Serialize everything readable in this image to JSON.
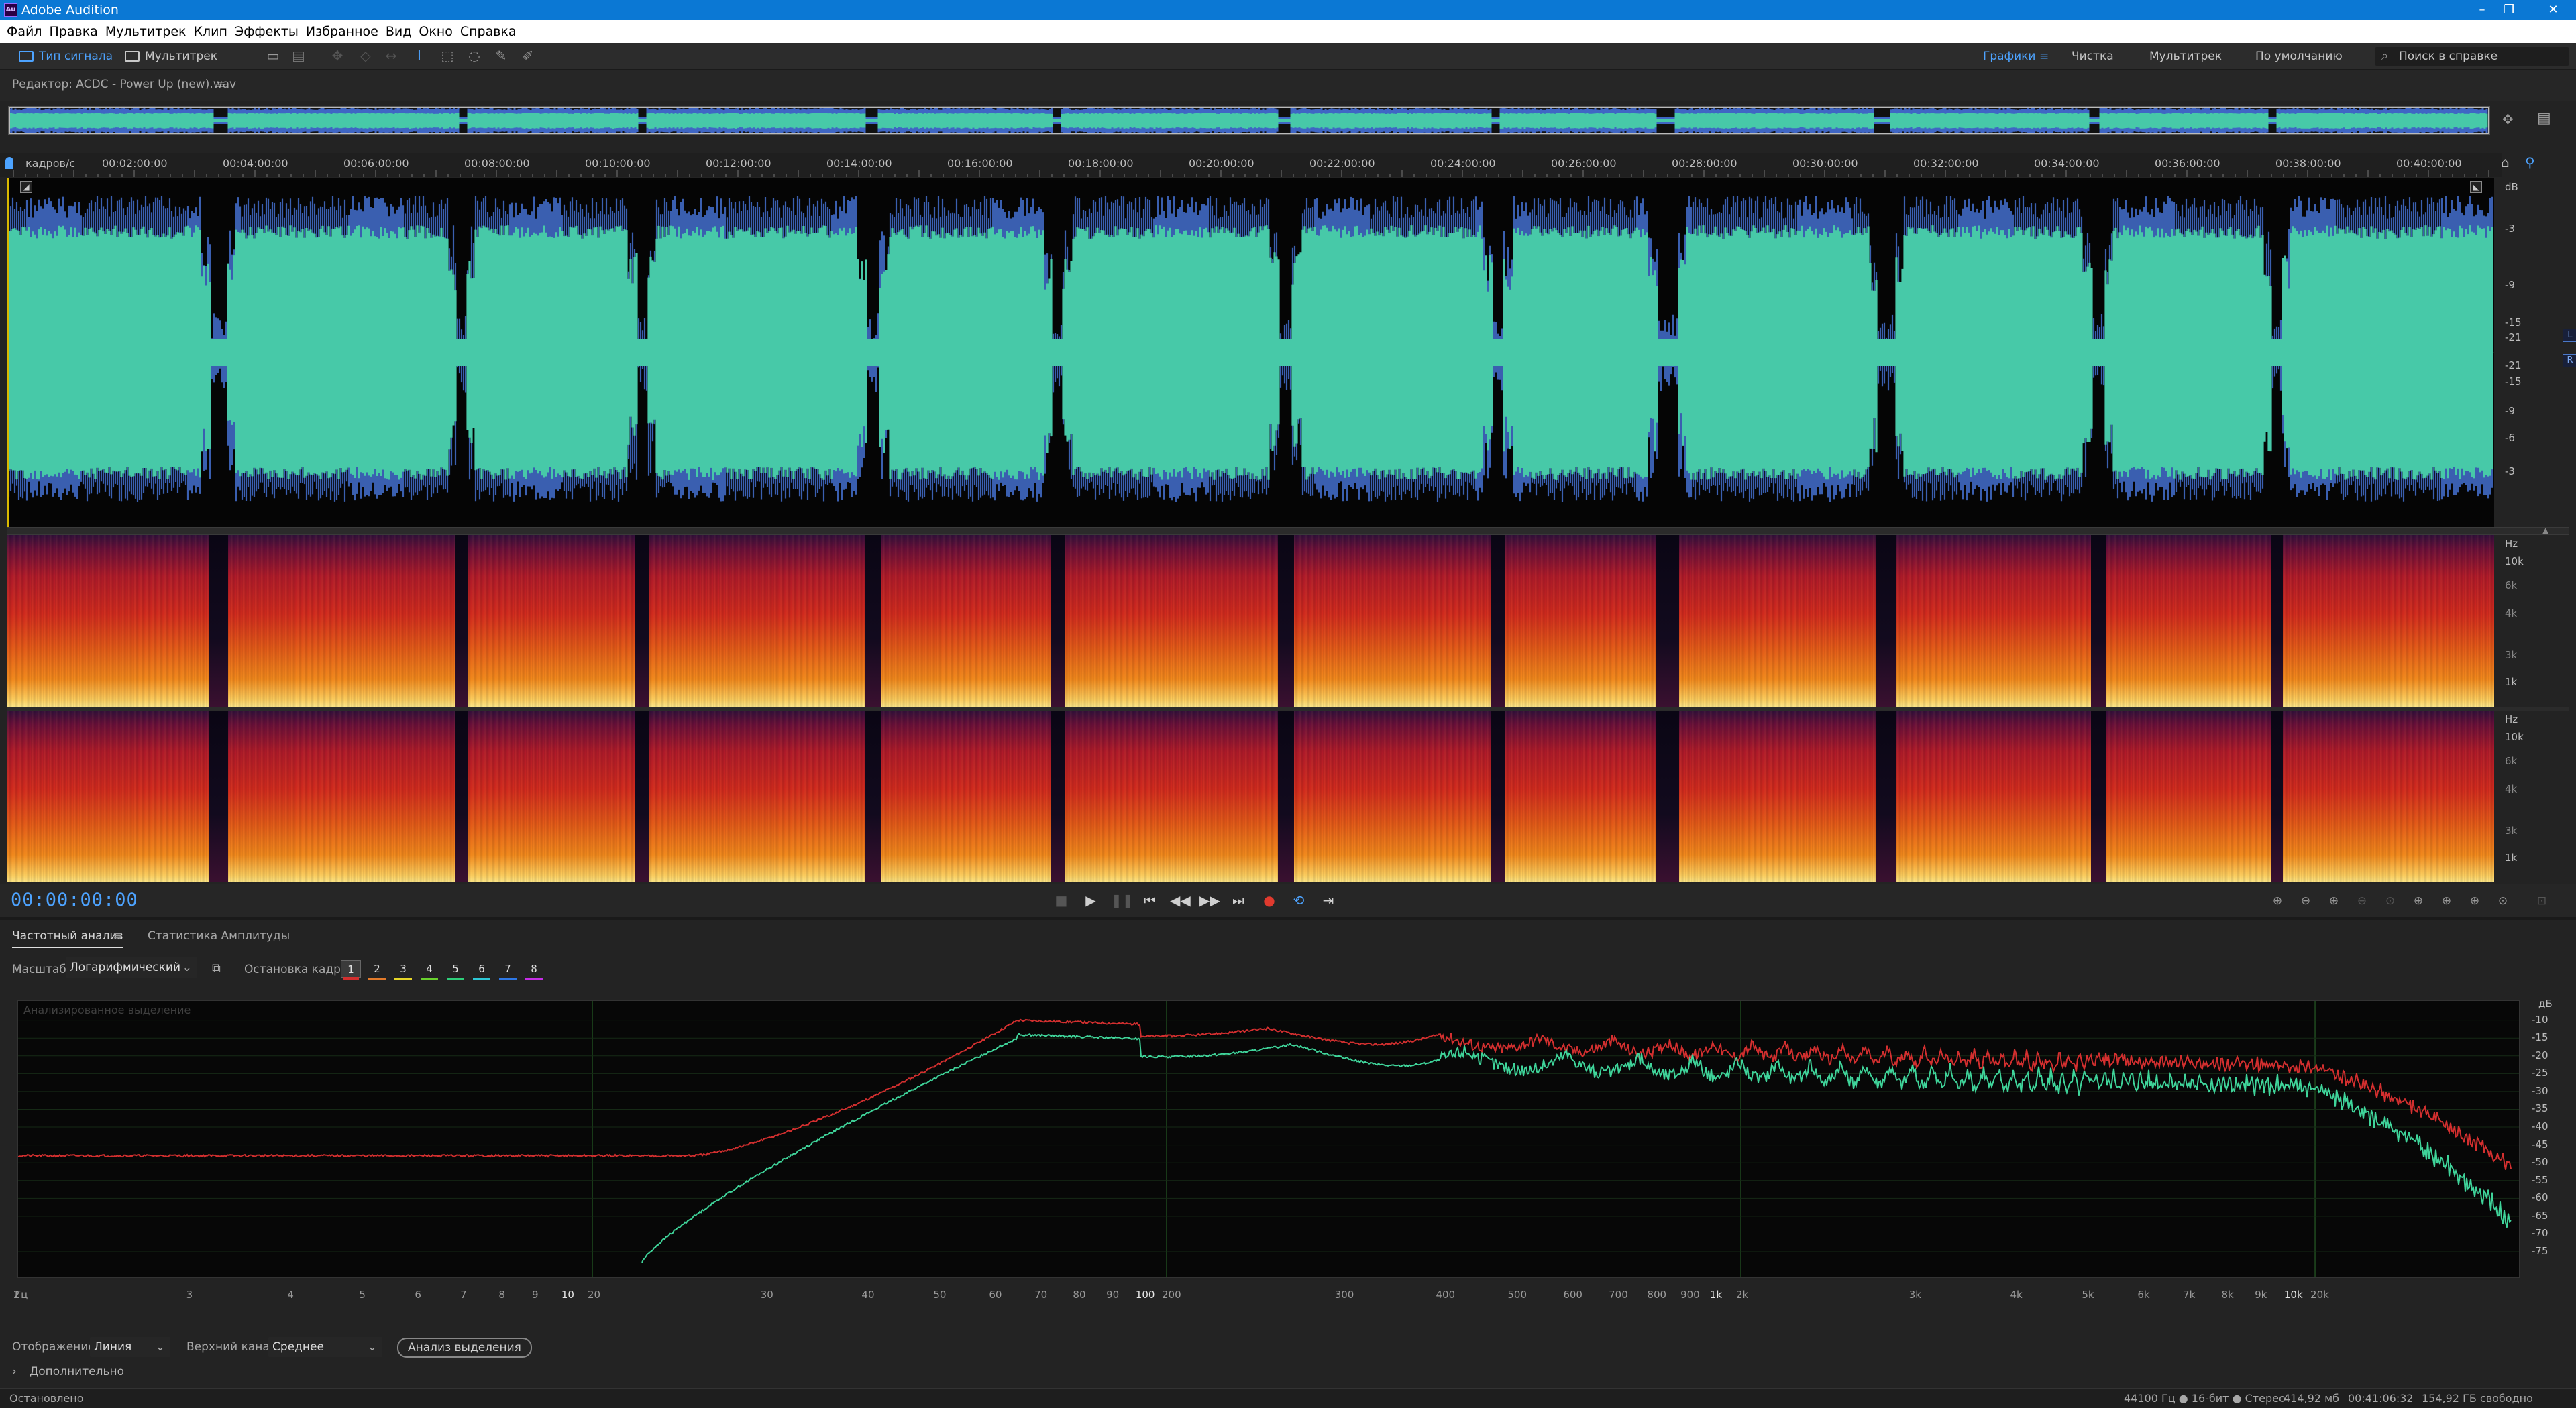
{
  "titlebar": {
    "app_icon": "Au",
    "title": "Adobe Audition",
    "minimize_icon": "–",
    "restore_icon": "❐",
    "close_icon": "✕"
  },
  "menu": [
    "Файл",
    "Правка",
    "Мультитрек",
    "Клип",
    "Эффекты",
    "Избранное",
    "Вид",
    "Окно",
    "Справка"
  ],
  "toolbar": {
    "waveform_tab": "Тип сигнала",
    "multitrack_tab": "Мультитрек",
    "workspaces": [
      "Графики",
      "Чистка",
      "Мультитрек",
      "По умолчанию"
    ],
    "search_placeholder": "Поиск в справке"
  },
  "editor": {
    "title": "Редактор: ACDC - Power Up (new).wav",
    "menu_icon": "≡"
  },
  "ruler": {
    "units_label": "кадров/с",
    "labels": [
      "00:02:00:00",
      "00:04:00:00",
      "00:06:00:00",
      "00:08:00:00",
      "00:10:00:00",
      "00:12:00:00",
      "00:14:00:00",
      "00:16:00:00",
      "00:18:00:00",
      "00:20:00:00",
      "00:22:00:00",
      "00:24:00:00",
      "00:26:00:00",
      "00:28:00:00",
      "00:30:00:00",
      "00:32:00:00",
      "00:34:00:00",
      "00:36:00:00",
      "00:38:00:00",
      "00:40:00:00"
    ]
  },
  "wave_scale": {
    "unit": "dB",
    "labels": [
      "-3",
      "-9",
      "-15",
      "-21",
      "-21",
      "-15",
      "-9",
      "-6",
      "-3"
    ],
    "left_badge": "L",
    "right_badge": "R"
  },
  "spec_scale": {
    "unit": "Hz",
    "labels": [
      "10k",
      "6k",
      "4k",
      "3k",
      "1k"
    ]
  },
  "transport": {
    "timecode": "00:00:00:00"
  },
  "freq_panel": {
    "tabs": [
      "Частотный анализ",
      "Статистика Амплитуды"
    ],
    "scale_label": "Масштаб:",
    "scale_value": "Логарифмический",
    "frame_label": "Остановка кадра:",
    "frames": [
      {
        "n": "1",
        "color": "#d32f2f"
      },
      {
        "n": "2",
        "color": "#e27a2a"
      },
      {
        "n": "3",
        "color": "#e6d628"
      },
      {
        "n": "4",
        "color": "#6ad12e"
      },
      {
        "n": "5",
        "color": "#2ecf7a"
      },
      {
        "n": "6",
        "color": "#2ec8d6"
      },
      {
        "n": "7",
        "color": "#2e78e6"
      },
      {
        "n": "8",
        "color": "#c62ee6"
      }
    ],
    "plot_title": "Анализированное выделение",
    "db_unit": "дБ",
    "db_labels": [
      "-10",
      "-15",
      "-20",
      "-25",
      "-30",
      "-35",
      "-40",
      "-45",
      "-50",
      "-55",
      "-60",
      "-65",
      "-70",
      "-75"
    ],
    "x_labels": [
      "Гц",
      "2",
      "3",
      "4",
      "5",
      "6",
      "7",
      "8",
      "9",
      "10",
      "20",
      "30",
      "40",
      "50",
      "60",
      "70",
      "80",
      "90",
      "100",
      "200",
      "300",
      "400",
      "500",
      "600",
      "700",
      "800",
      "900",
      "1k",
      "2k",
      "3k",
      "4k",
      "5k",
      "6k",
      "7k",
      "8k",
      "9k",
      "10k",
      "20k"
    ],
    "display_label": "Отображение:",
    "display_value": "Линия",
    "channel_label": "Верхний канал:",
    "channel_value": "Среднее",
    "analyze_button": "Анализ выделения",
    "advanced": "Дополнительно",
    "advanced_chevron": "›"
  },
  "status": {
    "left": "Остановлено",
    "sample": "44100 Гц ● 16-бит ● Стерео",
    "size": "414,92 мб",
    "duration": "00:41:06:32",
    "free": "154,92 ГБ свободно"
  },
  "colors": {
    "accent": "#4da3ff",
    "waveform": "#47c9a8",
    "spectrum_line_1": "#d32f2f",
    "spectrum_line_2": "#3fd49a"
  }
}
